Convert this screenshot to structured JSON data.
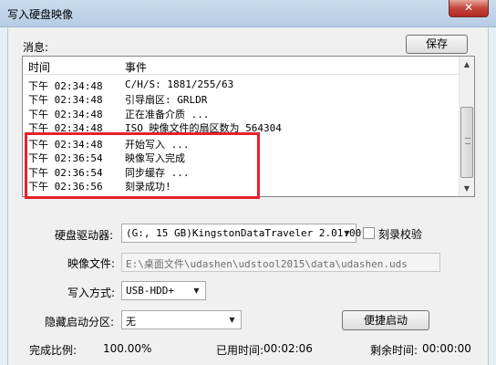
{
  "window": {
    "title": "写入硬盘映像",
    "close_glyph": "✕"
  },
  "messages": {
    "label": "消息:",
    "save_label": "保存",
    "col_time": "时间",
    "col_event": "事件",
    "rows": [
      {
        "time": "下午 02:34:48",
        "event": "C/H/S: 1881/255/63"
      },
      {
        "time": "下午 02:34:48",
        "event": "引导扇区: GRLDR"
      },
      {
        "time": "下午 02:34:48",
        "event": "正在准备介质 ..."
      },
      {
        "time": "下午 02:34:48",
        "event": "ISO 映像文件的扇区数为 564304"
      },
      {
        "time": "下午 02:34:48",
        "event": "开始写入 ..."
      },
      {
        "time": "下午 02:36:54",
        "event": "映像写入完成"
      },
      {
        "time": "下午 02:36:54",
        "event": "同步缓存 ..."
      },
      {
        "time": "下午 02:36:56",
        "event": "刻录成功!"
      }
    ]
  },
  "form": {
    "drive_label": "硬盘驱动器:",
    "drive_value": "(G:, 15 GB)KingstonDataTraveler 2.01.00",
    "verify_label": "刻录校验",
    "image_label": "映像文件:",
    "image_value": "E:\\桌面文件\\udashen\\udstool2015\\data\\udashen.uds",
    "write_mode_label": "写入方式:",
    "write_mode_value": "USB-HDD+",
    "hidden_part_label": "隐藏启动分区:",
    "hidden_part_value": "无",
    "boot_button": "便捷启动"
  },
  "status": {
    "ratio_label": "完成比例:",
    "ratio_value": "100.00%",
    "elapsed_label": "已用时间:",
    "elapsed_value": "00:02:06",
    "remaining_label": "剩余时间:",
    "remaining_value": "00:00:00"
  }
}
